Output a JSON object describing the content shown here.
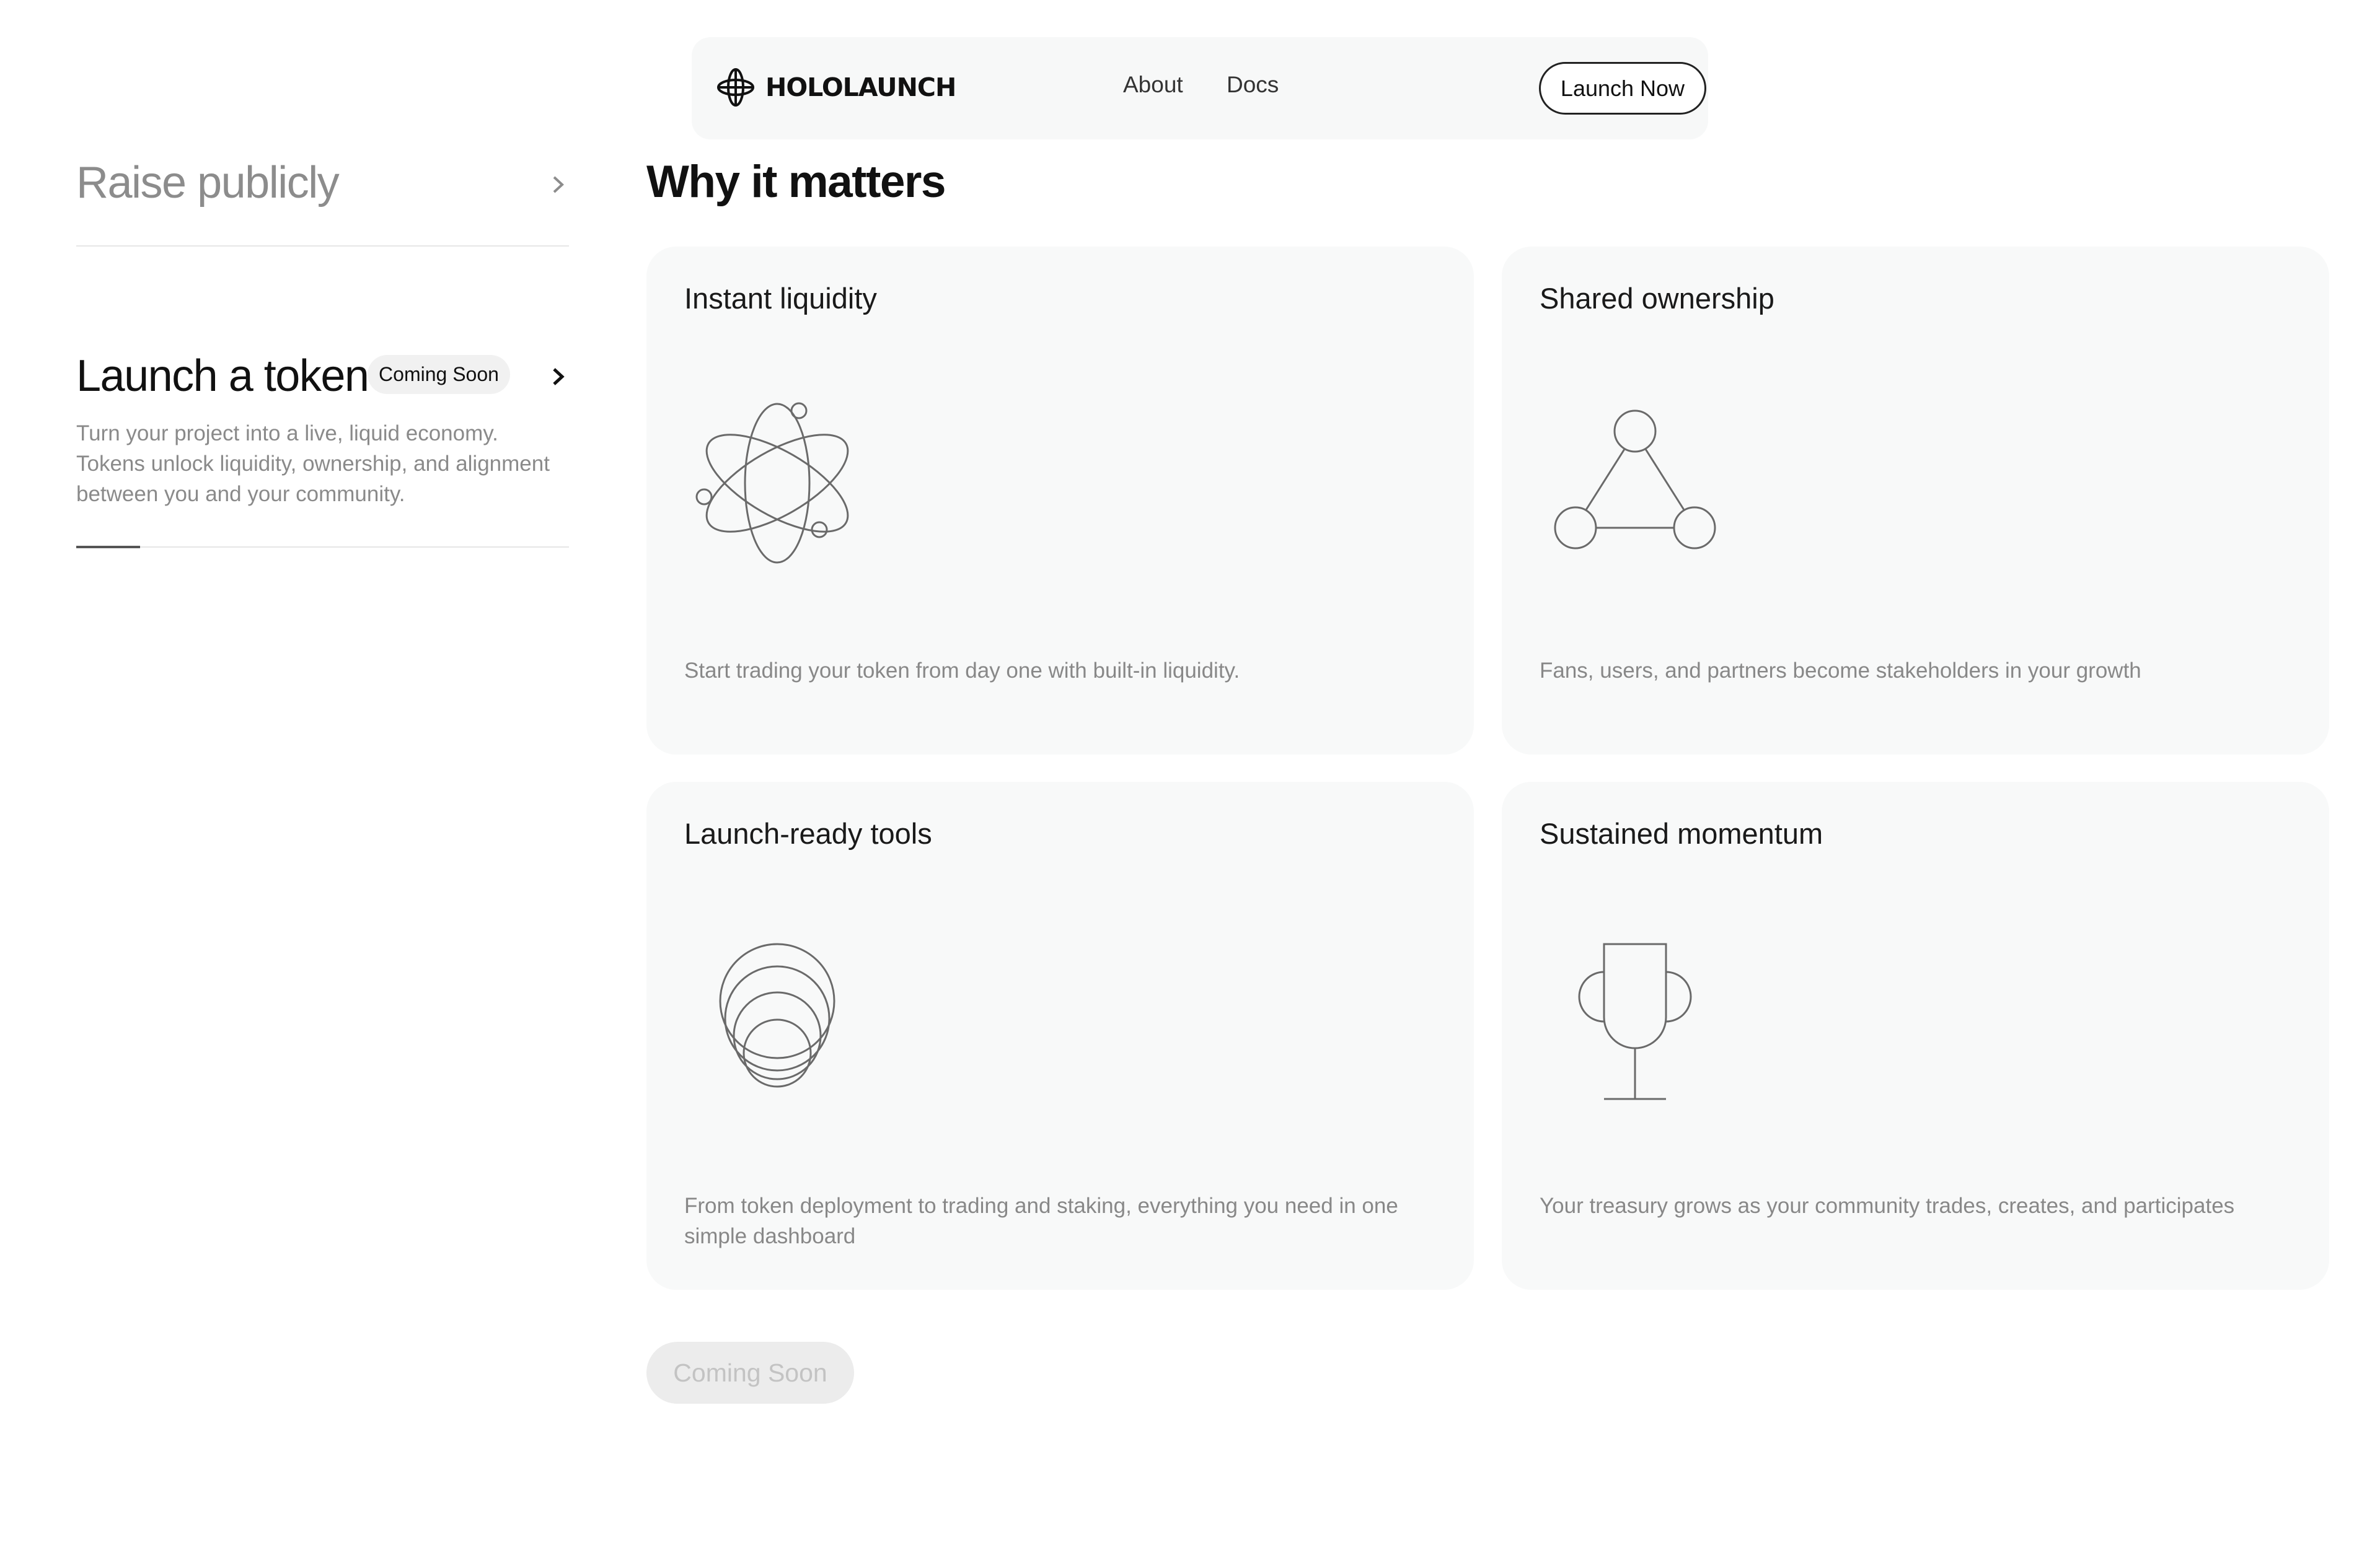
{
  "header": {
    "brand": "HOLOLAUNCH",
    "links": [
      "About",
      "Docs"
    ],
    "cta_label": "Launch Now"
  },
  "sidebar": {
    "items": [
      {
        "title": "Raise publicly",
        "active": false
      },
      {
        "title": "Launch a token",
        "badge": "Coming Soon",
        "description": "Turn your project into a live, liquid economy. Tokens unlock liquidity, ownership, and alignment between you and your community.",
        "active": true
      }
    ]
  },
  "main": {
    "title": "Why it matters",
    "cards": [
      {
        "title": "Instant liquidity",
        "icon": "atom-icon",
        "description": "Start trading your token from day one with built-in liquidity."
      },
      {
        "title": "Shared ownership",
        "icon": "network-triangle-icon",
        "description": "Fans, users, and partners become stakeholders in your growth"
      },
      {
        "title": "Launch-ready tools",
        "icon": "stacked-circles-icon",
        "description": "From token deployment to trading and staking, everything you need in one simple dashboard"
      },
      {
        "title": "Sustained momentum",
        "icon": "trophy-icon",
        "description": "Your treasury grows as your community trades, creates, and participates"
      }
    ],
    "cta_label": "Coming Soon"
  },
  "colors": {
    "card_bg": "#f8f9f9",
    "text_muted": "#8a8a8a",
    "icon_stroke": "#6a6a6a"
  }
}
